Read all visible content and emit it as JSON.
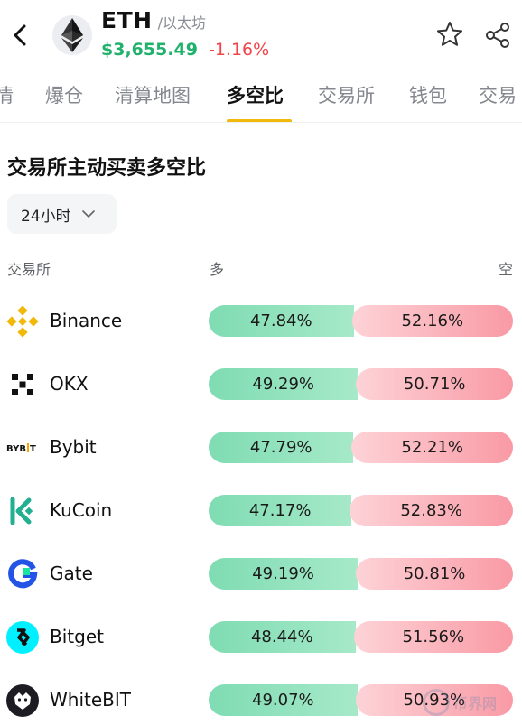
{
  "header": {
    "symbol": "ETH",
    "name": "/以太坊",
    "price": "$3,655.49",
    "change": "-1.16%"
  },
  "tabs": [
    {
      "label": "情"
    },
    {
      "label": "爆仓"
    },
    {
      "label": "清算地图"
    },
    {
      "label": "多空比"
    },
    {
      "label": "交易所"
    },
    {
      "label": "钱包"
    },
    {
      "label": "交易"
    }
  ],
  "section": {
    "title": "交易所主动买卖多空比",
    "period": "24小时"
  },
  "columns": {
    "exchange": "交易所",
    "long": "多",
    "short": "空"
  },
  "exchanges": [
    {
      "name": "Binance",
      "long": "47.84%",
      "short": "52.16%",
      "long_fraction": 0.4784,
      "icon": "binance-icon"
    },
    {
      "name": "OKX",
      "long": "49.29%",
      "short": "50.71%",
      "long_fraction": 0.4929,
      "icon": "okx-icon"
    },
    {
      "name": "Bybit",
      "long": "47.79%",
      "short": "52.21%",
      "long_fraction": 0.4779,
      "icon": "bybit-icon"
    },
    {
      "name": "KuCoin",
      "long": "47.17%",
      "short": "52.83%",
      "long_fraction": 0.4717,
      "icon": "kucoin-icon"
    },
    {
      "name": "Gate",
      "long": "49.19%",
      "short": "50.81%",
      "long_fraction": 0.4919,
      "icon": "gate-icon"
    },
    {
      "name": "Bitget",
      "long": "48.44%",
      "short": "51.56%",
      "long_fraction": 0.4844,
      "icon": "bitget-icon"
    },
    {
      "name": "WhiteBIT",
      "long": "49.07%",
      "short": "50.93%",
      "long_fraction": 0.4907,
      "icon": "whitebit-icon"
    }
  ],
  "colors": {
    "price_up": "#20b26c",
    "price_down": "#ef454a",
    "accent": "#f0b90b",
    "long_bar": "#7fdcb2",
    "short_bar": "#f99aa5"
  }
}
